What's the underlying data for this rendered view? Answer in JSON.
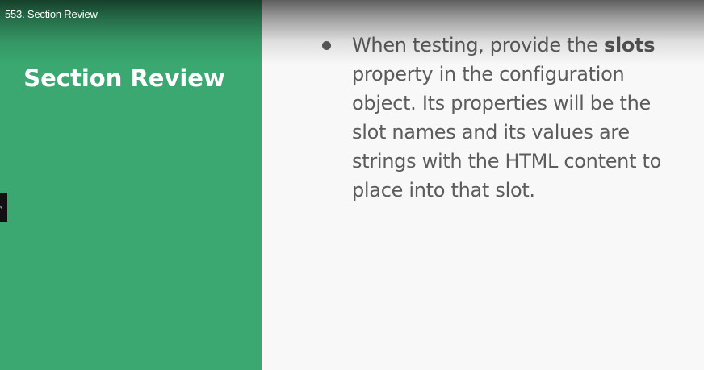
{
  "player": {
    "video_title": "553. Section Review"
  },
  "slide": {
    "section_title": "Section Review",
    "bullet": {
      "text_before": "When testing, provide the ",
      "emphasis": "slots",
      "text_after": " property in the configuration object. Its properties will be the slot names and its values are strings with the HTML content to place into that slot."
    }
  },
  "colors": {
    "left_panel": "#3aa870",
    "right_panel": "#f8f8f8",
    "body_text": "#5c5c5c"
  },
  "icons": {
    "side_handle": "chevron-icon"
  }
}
